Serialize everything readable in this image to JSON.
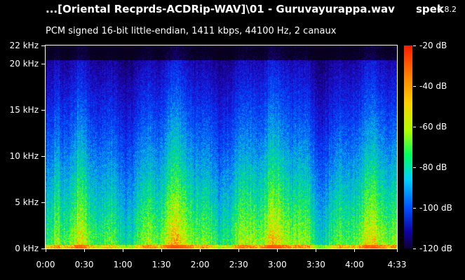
{
  "header": {
    "file_title": "...[Oriental Recprds-ACDRip-WAV]\\01 - Guruvayurappa.wav",
    "app_name": "spek",
    "app_version": "0.8.2",
    "stream_info": "PCM signed 16-bit little-endian, 1411 kbps, 44100 Hz, 2 canaux"
  },
  "chart_data": {
    "type": "heatmap",
    "x_axis": {
      "range_seconds": [
        0,
        273
      ],
      "tick_labels": [
        "0:00",
        "0:30",
        "1:00",
        "1:30",
        "2:00",
        "2:30",
        "3:00",
        "3:30",
        "4:00",
        "4:33"
      ],
      "tick_seconds": [
        0,
        30,
        60,
        90,
        120,
        150,
        180,
        210,
        240,
        273
      ]
    },
    "y_axis": {
      "range_khz": [
        0,
        22
      ],
      "tick_labels": [
        "0 kHz",
        "5 kHz",
        "10 kHz",
        "15 kHz",
        "20 kHz",
        "22 kHz"
      ],
      "tick_khz": [
        0,
        5,
        10,
        15,
        20,
        22
      ]
    },
    "colorbar": {
      "range_db": [
        -120,
        -20
      ],
      "tick_labels": [
        "-20 dB",
        "-40 dB",
        "-60 dB",
        "-80 dB",
        "-100 dB",
        "-120 dB"
      ],
      "tick_db": [
        -20,
        -40,
        -60,
        -80,
        -100,
        -120
      ]
    }
  }
}
